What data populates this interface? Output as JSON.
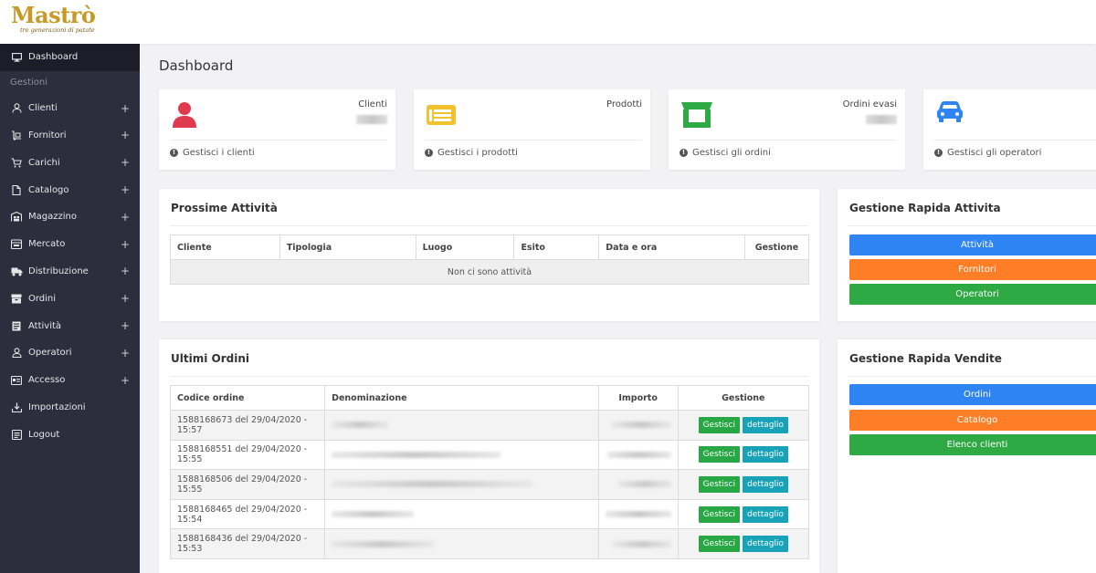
{
  "brand": {
    "name": "Mastrò",
    "tagline": "tre generazioni di patate"
  },
  "sidebar": {
    "top_item": {
      "label": "Dashboard",
      "icon": "monitor-icon"
    },
    "section_header": "Gestioni",
    "items": [
      {
        "label": "Clienti",
        "icon": "user-icon",
        "expandable": "+"
      },
      {
        "label": "Fornitori",
        "icon": "dolly-icon",
        "expandable": "+"
      },
      {
        "label": "Carichi",
        "icon": "cart-icon",
        "expandable": "+"
      },
      {
        "label": "Catalogo",
        "icon": "file-icon",
        "expandable": "+"
      },
      {
        "label": "Magazzino",
        "icon": "warehouse-icon",
        "expandable": "+"
      },
      {
        "label": "Mercato",
        "icon": "store-icon",
        "expandable": "+"
      },
      {
        "label": "Distribuzione",
        "icon": "truck-icon",
        "expandable": "+"
      },
      {
        "label": "Ordini",
        "icon": "box-icon",
        "expandable": "+"
      },
      {
        "label": "Attività",
        "icon": "clipboard-icon",
        "expandable": "+"
      },
      {
        "label": "Operatori",
        "icon": "operator-icon",
        "expandable": "+"
      },
      {
        "label": "Accesso",
        "icon": "id-card-icon",
        "expandable": "+"
      },
      {
        "label": "Importazioni",
        "icon": "download-icon",
        "expandable": ""
      },
      {
        "label": "Logout",
        "icon": "logout-icon",
        "expandable": ""
      }
    ]
  },
  "page": {
    "title": "Dashboard"
  },
  "stats": [
    {
      "label": "Clienti",
      "link": "Gestisci i clienti",
      "icon": "user-icon",
      "color": "#e03a4f"
    },
    {
      "label": "Prodotti",
      "link": "Gestisci i prodotti",
      "icon": "newspaper-icon",
      "color": "#f2c12e"
    },
    {
      "label": "Ordini evasi",
      "link": "Gestisci gli ordini",
      "icon": "store-icon",
      "color": "#2ea944"
    },
    {
      "label": "",
      "link": "Gestisci gli operatori",
      "icon": "car-icon",
      "color": "#2f84f3"
    }
  ],
  "activities": {
    "title": "Prossime Attività",
    "columns": [
      "Cliente",
      "Tipologia",
      "Luogo",
      "Esito",
      "Data e ora",
      "Gestione"
    ],
    "empty_text": "Non ci sono attività"
  },
  "quick_activities": {
    "title": "Gestione Rapida Attivita",
    "buttons": [
      "Attività",
      "Fornitori",
      "Operatori"
    ]
  },
  "orders": {
    "title": "Ultimi Ordini",
    "columns": [
      "Codice ordine",
      "Denominazione",
      "Importo",
      "Gestione"
    ],
    "rows": [
      {
        "code": "1588168673 del 29/04/2020 - 15:57",
        "btn1": "Gestisci",
        "btn2": "dettaglio"
      },
      {
        "code": "1588168551 del 29/04/2020 - 15:55",
        "btn1": "Gestisci",
        "btn2": "dettaglio"
      },
      {
        "code": "1588168506 del 29/04/2020 - 15:55",
        "btn1": "Gestisci",
        "btn2": "dettaglio"
      },
      {
        "code": "1588168465 del 29/04/2020 - 15:54",
        "btn1": "Gestisci",
        "btn2": "dettaglio"
      },
      {
        "code": "1588168436 del 29/04/2020 - 15:53",
        "btn1": "Gestisci",
        "btn2": "dettaglio"
      }
    ]
  },
  "quick_sales": {
    "title": "Gestione Rapida Vendite",
    "buttons": [
      "Ordini",
      "Catalogo",
      "Elenco clienti"
    ]
  }
}
